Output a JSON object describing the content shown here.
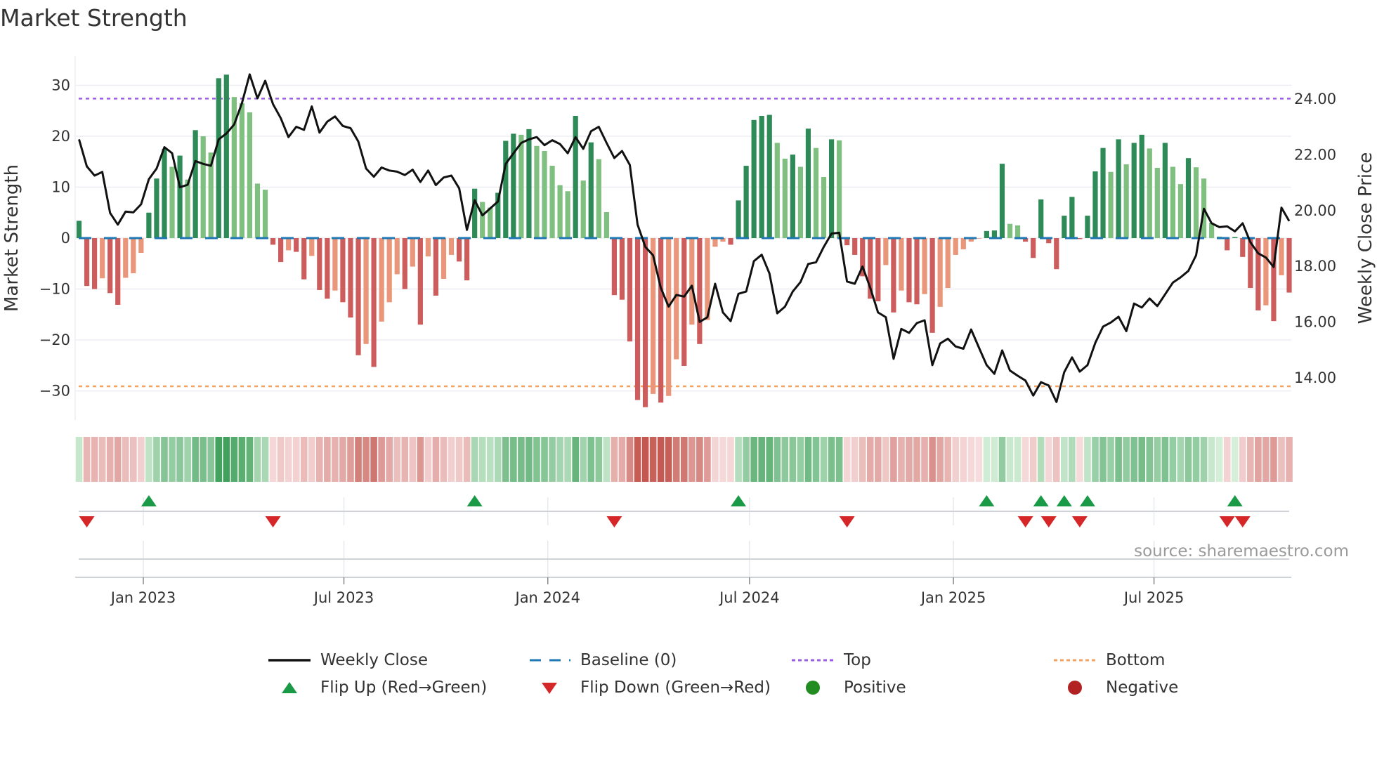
{
  "title": "Market Strength",
  "source": "source: sharemaestro.com",
  "colors": {
    "price_line": "#111111",
    "baseline": "#1f77b4",
    "top": "#9b5de5",
    "bottom": "#f4a261",
    "pos_rising": "#2e8b57",
    "pos_falling": "#7fbf7f",
    "neg_falling": "#cd5c5c",
    "neg_rising": "#e9967a",
    "flip_up": "#1a9a47",
    "flip_down": "#d62728",
    "positive_dot": "#228b22",
    "negative_dot": "#b22222"
  },
  "legend": [
    {
      "label": "Weekly Close",
      "symbol": "solid-line"
    },
    {
      "label": "Baseline (0)",
      "symbol": "dashed-line"
    },
    {
      "label": "Top",
      "symbol": "dotted-line-purple"
    },
    {
      "label": "Bottom",
      "symbol": "dotted-line-orange"
    },
    {
      "label": "Flip Up (Red→Green)",
      "symbol": "triangle-up"
    },
    {
      "label": "Flip Down (Green→Red)",
      "symbol": "triangle-down"
    },
    {
      "label": "Positive",
      "symbol": "dot-green"
    },
    {
      "label": "Negative",
      "symbol": "dot-red"
    }
  ],
  "chart_data": {
    "type": "bar",
    "title": "Market Strength",
    "ylabel": "Market Strength",
    "y2label": "Weekly Close Price",
    "ylim": [
      -36,
      36
    ],
    "y2lim": [
      12.9,
      25.4
    ],
    "yticks": [
      -30,
      -20,
      -10,
      0,
      10,
      20,
      30
    ],
    "y2ticks": [
      "14.00",
      "16.00",
      "18.00",
      "20.00",
      "22.00",
      "24.00"
    ],
    "xticks": [
      {
        "label": "Jan 2023",
        "date": "2023-01-01"
      },
      {
        "label": "Jul 2023",
        "date": "2023-07-01"
      },
      {
        "label": "Jan 2024",
        "date": "2024-01-01"
      },
      {
        "label": "Jul 2024",
        "date": "2024-07-01"
      },
      {
        "label": "Jan 2025",
        "date": "2025-01-01"
      },
      {
        "label": "Jul 2025",
        "date": "2025-07-01"
      }
    ],
    "start_date": "2022-11-04",
    "frequency": "weekly",
    "top_level": 27.4,
    "bottom_level": -29.1,
    "baseline": 0,
    "grid": true,
    "legend_position": "bottom",
    "strength": [
      3.4,
      -9.4,
      -10,
      -7.9,
      -10.8,
      -13.1,
      -7.8,
      -6.9,
      -2.9,
      5.0,
      11.7,
      17.5,
      14.0,
      16.2,
      11.5,
      21.2,
      20.0,
      16.8,
      31.4,
      32.1,
      27.7,
      26.5,
      24.7,
      10.7,
      9.5,
      -1.3,
      -4.7,
      -2.4,
      -2.7,
      -8.1,
      -3.5,
      -10.2,
      -11.9,
      -10.3,
      -12.6,
      -15.6,
      -23.0,
      -20.8,
      -25.3,
      -16.4,
      -12.6,
      -7.1,
      -10.0,
      -5.6,
      -17.0,
      -3.6,
      -11.3,
      -8.0,
      -3.3,
      -4.6,
      -8.3,
      9.7,
      7.1,
      6.0,
      8.9,
      19.1,
      20.5,
      20.3,
      21.4,
      18.1,
      17.1,
      14.2,
      10.4,
      9.2,
      24.0,
      11.3,
      18.8,
      15.5,
      5.1,
      -11.2,
      -12.1,
      -20.3,
      -31.8,
      -33.2,
      -30.6,
      -32.3,
      -31.0,
      -23.8,
      -25.1,
      -17.0,
      -20.8,
      -16.1,
      -1.7,
      -0.7,
      -1.3,
      7.4,
      14.2,
      23.2,
      24.0,
      24.2,
      18.7,
      15.6,
      16.4,
      14.0,
      21.5,
      17.7,
      12.0,
      19.4,
      19.2,
      -1.4,
      -3.3,
      -7.5,
      -11.9,
      -12.4,
      -5.3,
      -14.6,
      -10.3,
      -12.6,
      -13.0,
      -11.0,
      -18.6,
      -13.5,
      -9.8,
      -3.3,
      -2.2,
      -0.7,
      -0.1,
      1.4,
      1.5,
      14.6,
      2.8,
      2.5,
      -0.7,
      -3.9,
      7.6,
      -1.0,
      -6.1,
      4.4,
      8.1,
      -0.2,
      4.4,
      13.1,
      17.7,
      13.0,
      19.4,
      14.5,
      18.7,
      20.3,
      17.6,
      13.8,
      18.7,
      14.0,
      10.6,
      15.7,
      13.9,
      11.7,
      3.0,
      0.3,
      -2.4,
      0.2,
      -3.7,
      -9.8,
      -14.2,
      -13.2,
      -16.3,
      -7.3,
      -10.7
    ],
    "price": [
      22.53,
      21.56,
      21.23,
      21.36,
      19.89,
      19.47,
      19.94,
      19.91,
      20.2,
      21.1,
      21.48,
      22.25,
      22.03,
      20.81,
      20.9,
      21.75,
      21.65,
      21.58,
      22.53,
      22.74,
      23.06,
      23.83,
      24.86,
      24.0,
      24.63,
      23.79,
      23.29,
      22.61,
      22.98,
      22.87,
      23.71,
      22.77,
      23.16,
      23.35,
      23.01,
      22.93,
      22.45,
      21.48,
      21.19,
      21.52,
      21.41,
      21.37,
      21.25,
      21.44,
      21.0,
      21.41,
      20.89,
      21.16,
      21.23,
      20.77,
      19.28,
      20.35,
      19.8,
      20.05,
      20.3,
      21.65,
      22.03,
      22.4,
      22.53,
      22.61,
      22.32,
      22.5,
      22.36,
      22.03,
      22.61,
      22.19,
      22.82,
      22.98,
      22.4,
      21.86,
      22.11,
      21.61,
      19.47,
      18.67,
      18.37,
      17.2,
      16.53,
      16.95,
      16.89,
      17.28,
      15.98,
      16.15,
      17.35,
      16.32,
      16.01,
      16.99,
      17.07,
      18.16,
      18.39,
      17.72,
      16.29,
      16.53,
      17.07,
      17.41,
      18.06,
      18.12,
      18.67,
      19.15,
      19.18,
      17.43,
      17.35,
      17.97,
      17.2,
      16.32,
      16.15,
      14.66,
      15.73,
      15.59,
      15.94,
      16.04,
      14.43,
      15.21,
      15.38,
      15.1,
      15.02,
      15.71,
      15.06,
      14.43,
      14.12,
      14.96,
      14.24,
      14.05,
      13.88,
      13.34,
      13.82,
      13.7,
      13.11,
      14.18,
      14.71,
      14.2,
      14.43,
      15.23,
      15.81,
      15.96,
      16.17,
      15.65,
      16.64,
      16.5,
      16.82,
      16.55,
      16.97,
      17.39,
      17.58,
      17.81,
      18.37,
      20.04,
      19.52,
      19.38,
      19.41,
      19.23,
      19.52,
      18.84,
      18.44,
      18.29,
      17.95,
      20.08,
      19.6
    ]
  }
}
